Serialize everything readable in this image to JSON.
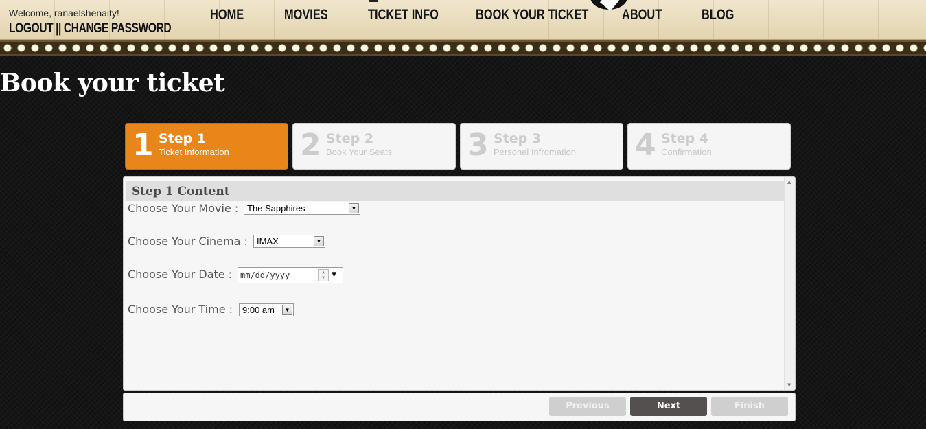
{
  "header": {
    "welcome": "Welcome, ranaelshenaity!",
    "logout_label": "LOGOUT",
    "separator": "||",
    "change_password_label": "CHANGE PASSWORD",
    "nav": [
      "HOME",
      "MOVIES",
      "TICKET INFO",
      "BOOK YOUR TICKET",
      "ABOUT",
      "BLOG"
    ]
  },
  "page": {
    "title": "Book your ticket"
  },
  "wizard": {
    "active_step": 1,
    "steps": [
      {
        "number": "1",
        "title": "Step 1",
        "subtitle": "Ticket Information"
      },
      {
        "number": "2",
        "title": "Step 2",
        "subtitle": "Book Your Seats"
      },
      {
        "number": "3",
        "title": "Step 3",
        "subtitle": "Personal Infromation"
      },
      {
        "number": "4",
        "title": "Step 4",
        "subtitle": "Confirmation"
      }
    ],
    "content_title": "Step 1 Content",
    "form": {
      "movie_label": "Choose Your Movie :",
      "movie_value": "The Sapphires",
      "cinema_label": "Choose Your Cinema :",
      "cinema_value": "IMAX",
      "date_label": "Choose Your Date :",
      "date_placeholder": "mm/dd/yyyy",
      "time_label": "Choose Your Time :",
      "time_value": "9:00 am"
    },
    "buttons": {
      "previous": "Previous",
      "next": "Next",
      "finish": "Finish"
    }
  },
  "colors": {
    "active_step": "#e8861a",
    "header_bg": "#ece0c4",
    "page_bg": "#141414",
    "next_button": "#555050"
  }
}
